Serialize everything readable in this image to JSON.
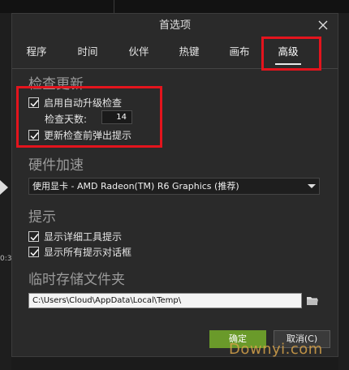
{
  "dialog": {
    "title": "首选项",
    "tabs": [
      {
        "label": "程序",
        "active": false
      },
      {
        "label": "时间",
        "active": false
      },
      {
        "label": "伙伴",
        "active": false
      },
      {
        "label": "热键",
        "active": false
      },
      {
        "label": "画布",
        "active": false
      },
      {
        "label": "高级",
        "active": true
      }
    ]
  },
  "update": {
    "title": "检查更新",
    "auto_check": {
      "label": "启用自动升级检查",
      "checked": true
    },
    "days_label": "检查天数:",
    "days_value": "14",
    "popup": {
      "label": "更新检查前弹出提示",
      "checked": true
    }
  },
  "hardware": {
    "title": "硬件加速",
    "gpu_selected": "使用显卡 - AMD Radeon(TM) R6 Graphics (推荐)"
  },
  "tips": {
    "title": "提示",
    "detail_tooltips": {
      "label": "显示详细工具提示",
      "checked": true
    },
    "all_dialogs": {
      "label": "显示所有提示对话框",
      "checked": true
    }
  },
  "temp": {
    "title": "临时存储文件夹",
    "path": "C:\\Users\\Cloud\\AppData\\Local\\Temp\\"
  },
  "buttons": {
    "ok": "确定",
    "cancel": "取消(C)"
  },
  "background": {
    "time_fragment": "0:3"
  },
  "watermark": "Downyi.com",
  "colors": {
    "accent_ok": "#6a9a2a",
    "highlight": "#e3141d"
  }
}
